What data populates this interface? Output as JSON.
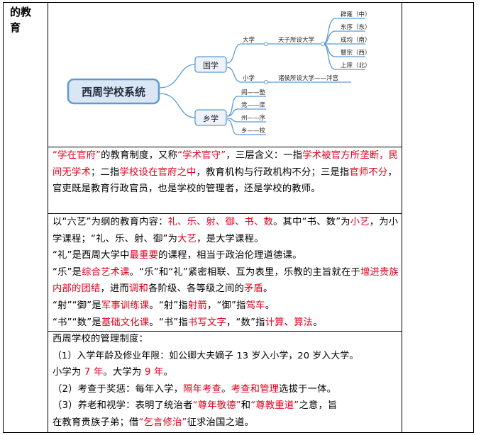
{
  "section_heading": "的教\n育",
  "diagram": {
    "root": "西周学校系统",
    "guoxue": "国学",
    "xiangxue": "乡学",
    "daxue": "大学",
    "daxue_desc": "天子所设大学",
    "xiaoxue": "小学",
    "xiaoxue_desc": "诸侯所设大学——泮宫",
    "daxue_items": [
      "辟雍（中）",
      "东序（东）",
      "成均（南）",
      "瞽宗（西）",
      "上庠（北）"
    ],
    "xiangxue_items": [
      "闾——塾",
      "党——庠",
      "州——序",
      "乡——校"
    ]
  },
  "p1": {
    "s1": "“学在官府”",
    "s2": "的教育制度，又称",
    "s3": "“学术官守”",
    "s4": "，三层含义：一指",
    "s5": "学术被官方所垄断，民间无学术",
    "s6": "；二指",
    "s7": "学校设在官府之中",
    "s8": "，教育机构与行政机构不分；三是指",
    "s9": "官师不分",
    "s10": "，官吏既是教育行政官员，也是学校的管理者，还是学校的教师。"
  },
  "p2": {
    "s1": "以“六艺”为纲的教育内容：",
    "s2": "礼、乐、射、御、书、数",
    "s3": "。其中“书、数”为",
    "s4": "小艺",
    "s5": "，为小学课程；“礼、乐、射、御”为",
    "s6": "大艺",
    "s7": "，是大学课程。"
  },
  "p3": {
    "s1": "“礼”是西周大学中",
    "s2": "最重要",
    "s3": "的课程，相当于政治伦理道德课。"
  },
  "p4": {
    "s1": "“乐”是",
    "s2": "综合艺术课",
    "s3": "。“乐”和“礼”紧密相联、互为表里，乐教的主旨就在于",
    "s4": "增进贵族内部的团结",
    "s5": "，进而",
    "s6": "调和",
    "s7": "各阶级、各等级之间的",
    "s8": "矛盾",
    "s9": "。"
  },
  "p5": {
    "s1": "“射”“御”是",
    "s2": "军事训练课",
    "s3": "。“射”指",
    "s4": "射箭",
    "s5": "，“御”指",
    "s6": "驾车",
    "s7": "。"
  },
  "p6": {
    "s1": "“书”“数”是",
    "s2": "基础文化课",
    "s3": "。“书”指",
    "s4": "书写文字",
    "s5": "，“数”指",
    "s6": "计算",
    "s7": "、",
    "s8": "算法",
    "s9": "。"
  },
  "mgmt": {
    "title": "西周学校的管理制度：",
    "l1": "（1）入学年龄及修业年限：如公卿大夫嫡子 13 岁入小学，20 岁入大学。",
    "l2a": "小学为 ",
    "l2b": "7 年",
    "l2c": "。大学为 ",
    "l2d": "9 年",
    "l2e": "。",
    "l3a": "（2）考查于奖惩：每年入学，",
    "l3b": "隔年考查",
    "l3c": "。",
    "l3d": "考查和管理",
    "l3e": "选拔于一体。",
    "l4a": "（3）养老和视学：表明了统治者",
    "l4b": "“尊年敬德”",
    "l4c": "和",
    "l4d": "“尊教重道”",
    "l4e": "之意，旨",
    "l5a": "在教育贵族子弟；借",
    "l5b": "“乞言修治”",
    "l5c": "征求治国之道。"
  }
}
